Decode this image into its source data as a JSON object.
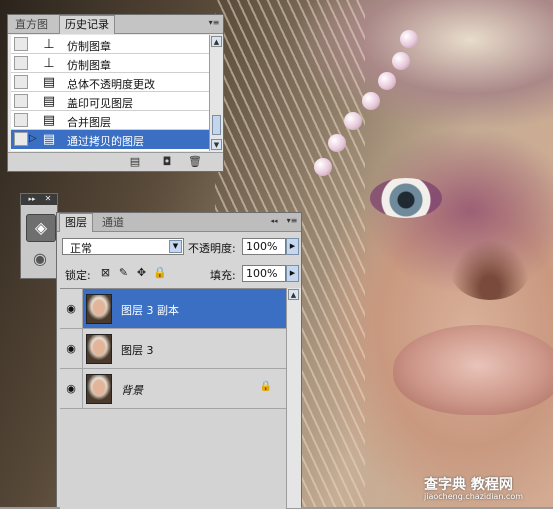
{
  "watermark": {
    "title": "查字典 教程网",
    "url": "jiaocheng.chazidian.com"
  },
  "history_panel": {
    "tabs": [
      "直方图",
      "历史记录"
    ],
    "active_tab": "历史记录",
    "menu_icon": "panel-menu-icon",
    "items": [
      {
        "label": "仿制图章",
        "icon": "clone-stamp-icon"
      },
      {
        "label": "仿制图章",
        "icon": "clone-stamp-icon"
      },
      {
        "label": "总体不透明度更改",
        "icon": "history-state-icon"
      },
      {
        "label": "盖印可见图层",
        "icon": "history-state-icon"
      },
      {
        "label": "合并图层",
        "icon": "history-state-icon"
      },
      {
        "label": "通过拷贝的图层",
        "icon": "history-state-icon",
        "selected": true
      }
    ],
    "footer_icons": [
      "new-document-icon",
      "new-snapshot-icon",
      "trash-icon"
    ]
  },
  "toolstrip": {
    "buttons": [
      "layers-icon",
      "channels-icon"
    ]
  },
  "layers_panel": {
    "tabs": [
      "图层",
      "通道"
    ],
    "active_tab": "图层",
    "blend_mode": "正常",
    "opacity_label": "不透明度:",
    "opacity_value": "100%",
    "lock_label": "锁定:",
    "lock_icons": [
      "lock-transparent-icon",
      "lock-image-icon",
      "lock-position-icon",
      "lock-all-icon"
    ],
    "fill_label": "填充:",
    "fill_value": "100%",
    "layers": [
      {
        "name": "图层 3 副本",
        "visible": true,
        "selected": true
      },
      {
        "name": "图层 3",
        "visible": true,
        "selected": false
      },
      {
        "name": "背景",
        "visible": true,
        "selected": false,
        "locked": true,
        "italic": true
      }
    ]
  },
  "colors": {
    "selection": "#3a6fc4",
    "panel_bg": "#d6d6d6"
  }
}
